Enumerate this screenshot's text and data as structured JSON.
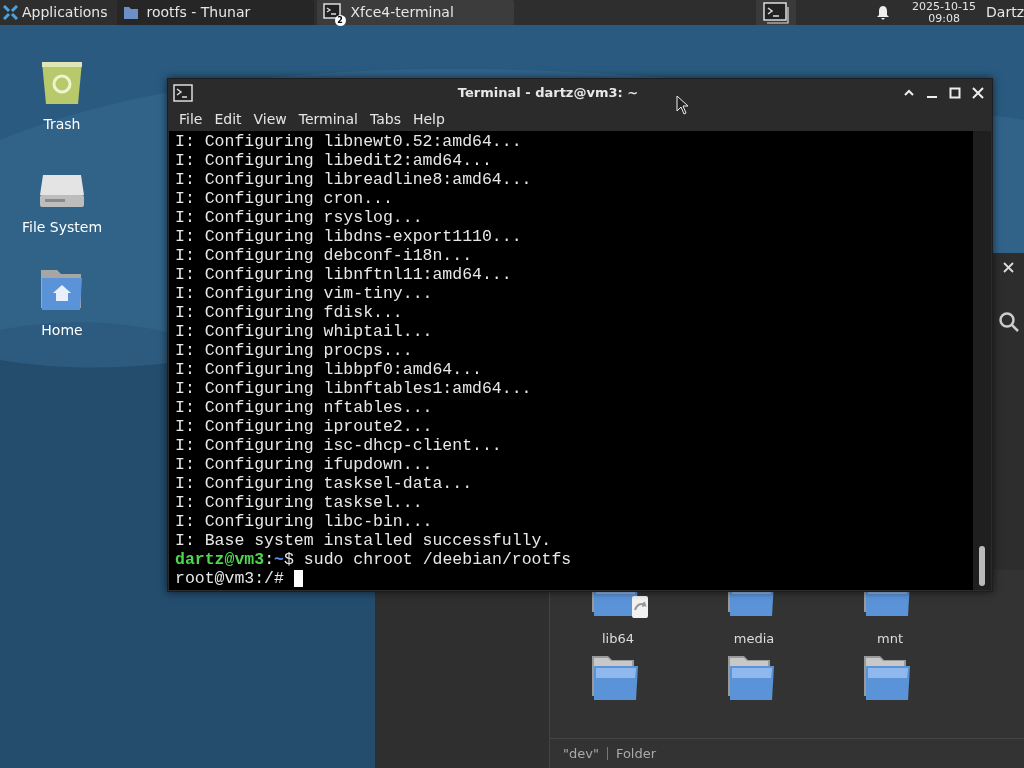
{
  "panel": {
    "applications": "Applications",
    "tasks": [
      {
        "label": "rootfs - Thunar",
        "kind": "folder",
        "selected": false
      },
      {
        "label": "Xfce4-terminal",
        "kind": "terminal",
        "selected": true,
        "badge": "2"
      }
    ],
    "clock": {
      "date": "2025-10-15",
      "time": "09:08"
    },
    "user": "Dartz"
  },
  "desktop_icons": [
    {
      "label": "Trash",
      "kind": "trash"
    },
    {
      "label": "File System",
      "kind": "drive"
    },
    {
      "label": "Home",
      "kind": "home"
    }
  ],
  "file_manager": {
    "folders": [
      {
        "label": "lib64",
        "link": true
      },
      {
        "label": "media",
        "link": false
      },
      {
        "label": "mnt",
        "link": false
      },
      {
        "link": false
      },
      {
        "link": false
      },
      {
        "link": false
      }
    ],
    "status": {
      "name": "\"dev\"",
      "type": "Folder"
    }
  },
  "terminal": {
    "title": "Terminal - dartz@vm3: ~",
    "menu": [
      "File",
      "Edit",
      "View",
      "Terminal",
      "Tabs",
      "Help"
    ],
    "lines": [
      "I: Configuring libnewt0.52:amd64...",
      "I: Configuring libedit2:amd64...",
      "I: Configuring libreadline8:amd64...",
      "I: Configuring cron...",
      "I: Configuring rsyslog...",
      "I: Configuring libdns-export1110...",
      "I: Configuring debconf-i18n...",
      "I: Configuring libnftnl11:amd64...",
      "I: Configuring vim-tiny...",
      "I: Configuring fdisk...",
      "I: Configuring whiptail...",
      "I: Configuring procps...",
      "I: Configuring libbpf0:amd64...",
      "I: Configuring libnftables1:amd64...",
      "I: Configuring nftables...",
      "I: Configuring iproute2...",
      "I: Configuring isc-dhcp-client...",
      "I: Configuring ifupdown...",
      "I: Configuring tasksel-data...",
      "I: Configuring tasksel...",
      "I: Configuring libc-bin...",
      "I: Base system installed successfully."
    ],
    "prompt": {
      "user_host": "dartz@vm3",
      "separator": ":",
      "path": "~",
      "symbol": "$",
      "command": "sudo chroot /deebian/rootfs"
    },
    "root_prompt": "root@vm3:/#"
  }
}
